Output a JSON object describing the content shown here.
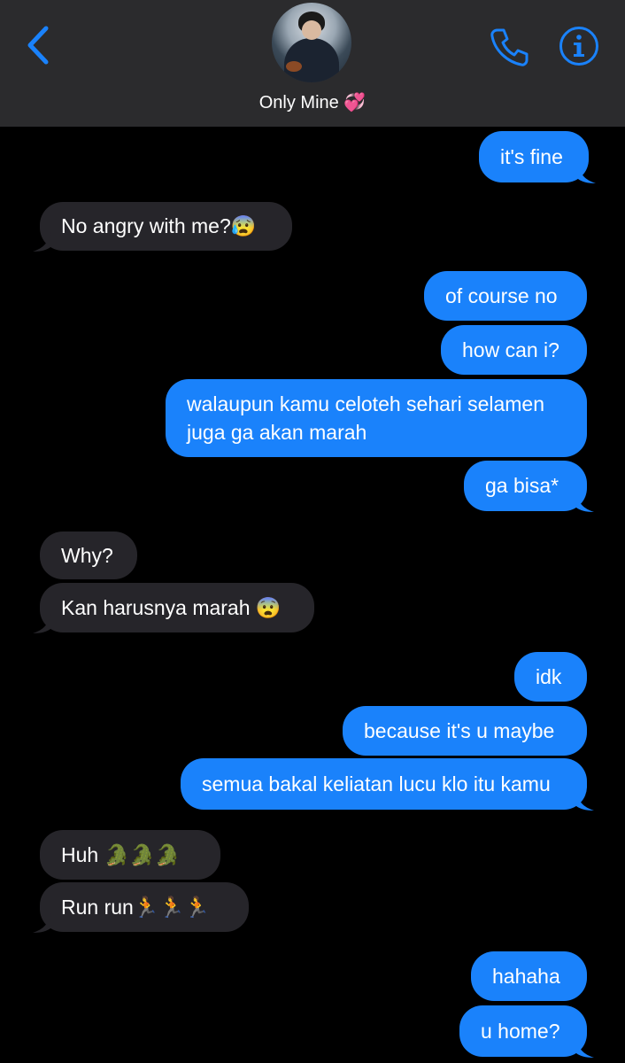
{
  "header": {
    "contact_name": "Only Mine",
    "contact_emoji": "💞",
    "back_icon": "chevron-left-icon",
    "call_icon": "phone-icon",
    "info_icon": "info-icon",
    "accent_color": "#1a82fb"
  },
  "messages": [
    {
      "side": "sent",
      "text": "it's fine"
    },
    {
      "side": "recv",
      "text": "No angry with me?😰"
    },
    {
      "side": "sent",
      "text": "of course no"
    },
    {
      "side": "sent",
      "text": "how can i?"
    },
    {
      "side": "sent",
      "text": "walaupun kamu celoteh sehari selamen\njuga ga akan marah"
    },
    {
      "side": "sent",
      "text": "ga bisa*"
    },
    {
      "side": "recv",
      "text": "Why?"
    },
    {
      "side": "recv",
      "text": "Kan harusnya marah 😨"
    },
    {
      "side": "sent",
      "text": "idk"
    },
    {
      "side": "sent",
      "text": "because it's u maybe"
    },
    {
      "side": "sent",
      "text": "semua bakal keliatan lucu klo itu kamu"
    },
    {
      "side": "recv",
      "text": "Huh 🐊🐊🐊"
    },
    {
      "side": "recv",
      "text": "Run run🏃🏃🏃"
    },
    {
      "side": "sent",
      "text": "hahaha"
    },
    {
      "side": "sent",
      "text": "u home?"
    }
  ],
  "colors": {
    "sent_bubble": "#1a82fb",
    "received_bubble": "#26252a",
    "background": "#000000",
    "header_background": "#2b2b2d"
  }
}
